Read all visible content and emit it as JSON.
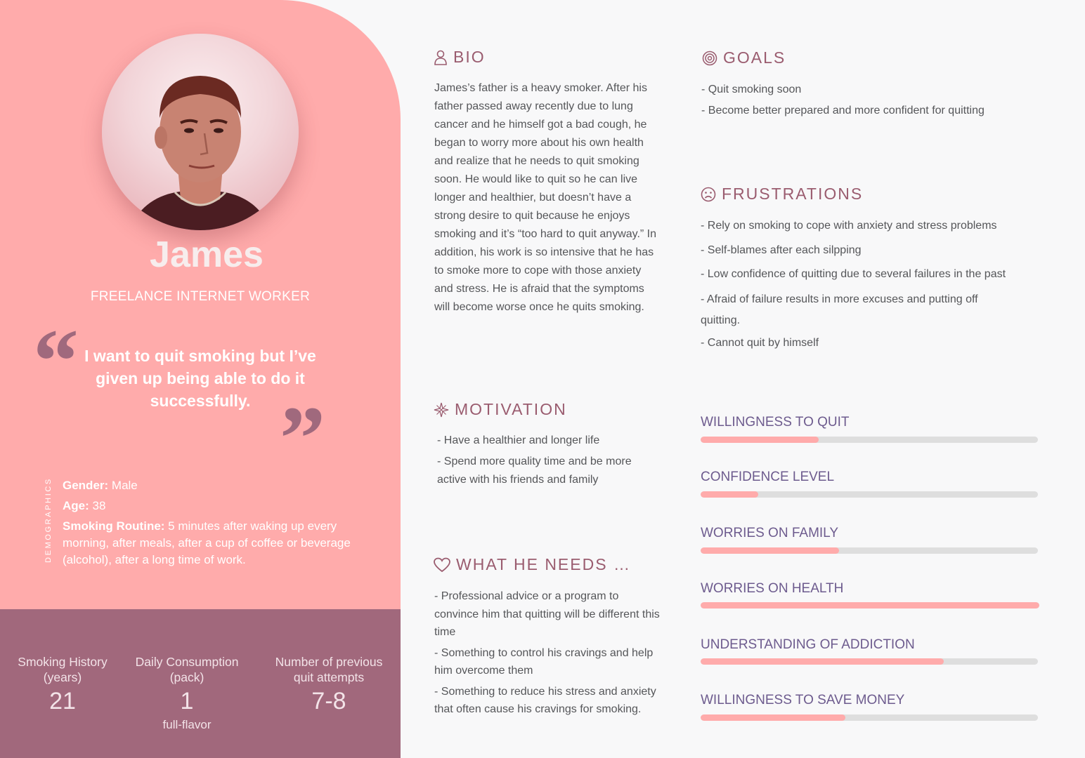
{
  "profile": {
    "name": "James",
    "role": "FREELANCE INTERNET WORKER",
    "quote": "I want to quit smoking but I’ve given up being able to do it successfully."
  },
  "demographics": {
    "label": "DEMOGRAPHICS",
    "gender_key": "Gender:",
    "gender_value": " Male",
    "age_key": "Age:",
    "age_value": " 38",
    "routine_key": "Smoking Routine:",
    "routine_value": " 5 minutes after waking up every morning, after meals, after a cup of coffee or beverage (alcohol), after a long time of work."
  },
  "stats": {
    "history_label_1": "Smoking History",
    "history_label_2": "(years)",
    "history_value": "21",
    "daily_label_1": "Daily Consumption",
    "daily_label_2": "(pack)",
    "daily_value": "1",
    "daily_note": "full-flavor",
    "attempts_label_1": "Number of previous",
    "attempts_label_2": "quit attempts",
    "attempts_value": "7-8"
  },
  "bio": {
    "title": "BIO",
    "text": "James’s father is a heavy smoker. After his father passed away recently due to lung cancer and he himself got a bad cough, he began to worry more about his own health and realize that he needs to quit smoking soon. He would like to quit so he can live longer and healthier, but doesn’t have a strong desire to quit because he enjoys smoking and it’s “too hard to quit anyway.” In addition, his work is so intensive that he has to smoke more to cope with those anxiety and stress. He is afraid that the symptoms will become worse once he quits smoking."
  },
  "goals": {
    "title": "GOALS",
    "items": [
      "- Quit smoking soon",
      "- Become better prepared and more confident for quitting"
    ]
  },
  "frustrations": {
    "title": "FRUSTRATIONS",
    "items": [
      "- Rely on smoking to cope with anxiety and stress problems",
      "- Self-blames after each silpping",
      "- Low confidence of quitting due to several failures in the past",
      "- Afraid of failure results in more excuses and putting off quitting.",
      "- Cannot quit by himself"
    ]
  },
  "motivation": {
    "title": "MOTIVATION",
    "items": [
      "- Have a healthier and longer life",
      "- Spend more quality time and be more active with his friends and family"
    ]
  },
  "needs": {
    "title": "WHAT HE NEEDS …",
    "items": [
      "- Professional advice or a program to convince him that quitting will be different this time",
      "- Something to control his cravings and help him overcome them",
      "- Something to reduce his stress and anxiety that often cause his cravings for smoking."
    ]
  },
  "meters": [
    {
      "label": "WILLINGNESS TO QUIT",
      "level": 0.35
    },
    {
      "label": "CONFIDENCE LEVEL",
      "level": 0.17
    },
    {
      "label": "WORRIES ON FAMILY",
      "level": 0.41
    },
    {
      "label": "WORRIES ON HEALTH",
      "level": 1.0
    },
    {
      "label": "UNDERSTANDING OF ADDICTION",
      "level": 0.72
    },
    {
      "label": "WILLINGNESS TO SAVE MONEY",
      "level": 0.43
    }
  ],
  "colors": {
    "panel": "#ffabab",
    "stats_bar": "#a1687c",
    "title": "#9a5c6f",
    "meter_label": "#6d5b8e",
    "meter_fill": "#ffabab",
    "meter_track": "#dedede"
  },
  "icons": {
    "bio": "person-icon",
    "goals": "target-icon",
    "frustrations": "frown-icon",
    "motivation": "compass-star-icon",
    "needs": "heart-icon"
  }
}
